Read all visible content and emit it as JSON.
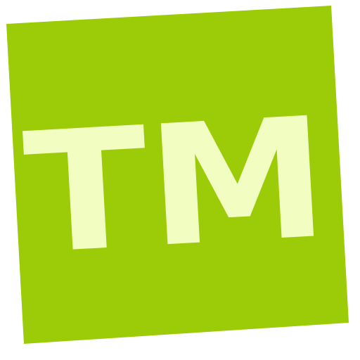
{
  "logo": {
    "text": "TM",
    "background_color": "#9ccb08",
    "text_color": "#f2fdc2"
  }
}
